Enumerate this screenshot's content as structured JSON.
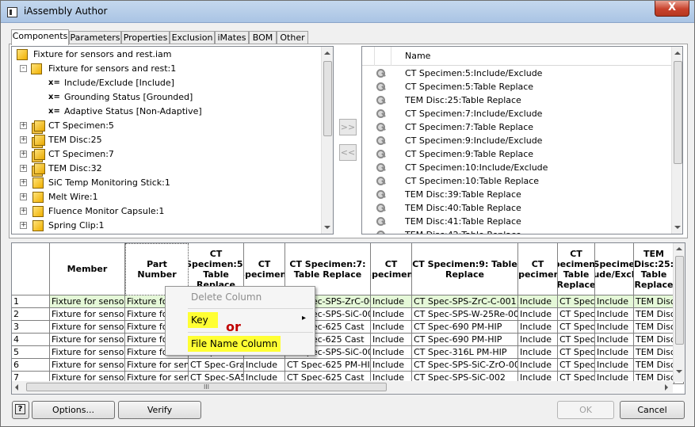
{
  "window": {
    "title": "iAssembly Author",
    "close_glyph": "X"
  },
  "tabs": [
    {
      "label": "Components",
      "active": true
    },
    {
      "label": "Parameters"
    },
    {
      "label": "Properties"
    },
    {
      "label": "Exclusion"
    },
    {
      "label": "iMates"
    },
    {
      "label": "BOM"
    },
    {
      "label": "Other"
    }
  ],
  "tree": [
    {
      "label": "Fixture for sensors and rest.iam",
      "icon": "assembly-icon"
    },
    {
      "label": "Fixture for sensors and rest:1",
      "icon": "assembly-icon",
      "expander": "-"
    },
    {
      "label": "Include/Exclude [Include]",
      "icon": "parameter-icon",
      "glyph": "x="
    },
    {
      "label": "Grounding Status [Grounded]",
      "icon": "parameter-icon",
      "glyph": "x="
    },
    {
      "label": "Adaptive Status [Non-Adaptive]",
      "icon": "parameter-icon",
      "glyph": "x="
    },
    {
      "label": "CT Specimen:5",
      "icon": "multi-assembly-icon",
      "expander": "+"
    },
    {
      "label": "TEM Disc:25",
      "icon": "multi-assembly-icon",
      "expander": "+"
    },
    {
      "label": "CT Specimen:7",
      "icon": "multi-assembly-icon",
      "expander": "+"
    },
    {
      "label": "TEM Disc:32",
      "icon": "multi-assembly-icon",
      "expander": "+"
    },
    {
      "label": "SiC Temp Monitoring Stick:1",
      "icon": "assembly-icon",
      "expander": "+"
    },
    {
      "label": "Melt Wire:1",
      "icon": "assembly-icon",
      "expander": "+"
    },
    {
      "label": "Fluence Monitor Capsule:1",
      "icon": "assembly-icon",
      "expander": "+"
    },
    {
      "label": "Spring Clip:1",
      "icon": "assembly-icon",
      "expander": "+"
    }
  ],
  "move_buttons": {
    "add": ">>",
    "remove": "<<"
  },
  "keylist": {
    "header": "Name",
    "items": [
      "CT Specimen:5:Include/Exclude",
      "CT Specimen:5:Table Replace",
      "TEM Disc:25:Table Replace",
      "CT Specimen:7:Include/Exclude",
      "CT Specimen:7:Table Replace",
      "CT Specimen:9:Include/Exclude",
      "CT Specimen:9:Table Replace",
      "CT Specimen:10:Include/Exclude",
      "CT Specimen:10:Table Replace",
      "TEM Disc:39:Table Replace",
      "TEM Disc:40:Table Replace",
      "TEM Disc:41:Table Replace",
      "TEM Disc:42:Table Replace"
    ]
  },
  "grid": {
    "headers": [
      "",
      "Member",
      "Part Number",
      "CT Specimen:5: Table Replace",
      "CT Specimen:",
      "CT Specimen:7: Table Replace",
      "CT Specimen:",
      "CT Specimen:9: Table Replace",
      "CT Specimen:",
      "CT Specimen:1 Table Replace",
      "CT Specimen:1 Include/Exclude",
      "TEM Disc:25: Table Replace",
      "T"
    ],
    "rows": [
      [
        "1",
        "Fixture for sensors",
        "Fixture for s",
        "CT Spec-Grad",
        "Include",
        "CT Spec-SPS-ZrC-001",
        "Include",
        "CT Spec-SPS-ZrC-C-001",
        "Include",
        "CT Spec-",
        "Include",
        "TEM Disc-",
        "In"
      ],
      [
        "2",
        "Fixture for sensors",
        "Fixture for s",
        "CT Spec-Grad",
        "Include",
        "CT Spec-SPS-SiC-001",
        "Include",
        "CT Spec-SPS-W-25Re-001",
        "Include",
        "CT Spec-",
        "Include",
        "TEM Disc-",
        "In"
      ],
      [
        "3",
        "Fixture for sensors",
        "Fixture for s",
        "CT Spec-Grad",
        "Include",
        "CT Spec-625 Cast",
        "Include",
        "CT Spec-690 PM-HIP",
        "Include",
        "CT Spec-",
        "Include",
        "TEM Disc-",
        "In"
      ],
      [
        "4",
        "Fixture for sensors",
        "Fixture for s",
        "CT Spec-Grad",
        "Include",
        "CT Spec-625 Cast",
        "Include",
        "CT Spec-690 PM-HIP",
        "Include",
        "CT Spec-",
        "Include",
        "TEM Disc-",
        "In"
      ],
      [
        "5",
        "Fixture for sensors",
        "Fixture for senso",
        "CT Spec-Grad",
        "Include",
        "CT Spec-SPS-SiC-003",
        "Include",
        "CT Spec-316L PM-HIP",
        "Include",
        "CT Spec-",
        "Include",
        "TEM Disc-",
        "In"
      ],
      [
        "6",
        "Fixture for sensors",
        "Fixture for senso",
        "CT Spec-Grad",
        "Include",
        "CT Spec-625 PM-HIP",
        "Include",
        "CT Spec-SPS-SiC-ZrO-002",
        "Include",
        "CT Spec-",
        "Include",
        "TEM Disc-",
        "In"
      ],
      [
        "7",
        "Fixture for sensors",
        "Fixture for senso",
        "CT Spec-SA50",
        "Include",
        "CT Spec-625 Cast",
        "Include",
        "CT Spec-SPS-SiC-002",
        "Include",
        "CT Spec-",
        "Include",
        "TEM Disc-",
        "In"
      ]
    ],
    "hscroll_thumb_glyph": "III"
  },
  "context_menu": {
    "items": [
      {
        "label": "Delete Column",
        "disabled": true
      },
      {
        "label": "Key",
        "highlighted": true,
        "submenu": true
      },
      {
        "label": "File Name Column",
        "highlighted": true
      }
    ],
    "submenu_glyph": "▸"
  },
  "annotation": {
    "or_label": "or"
  },
  "buttons": {
    "help": "?",
    "options": "Options...",
    "verify": "Verify",
    "ok": "OK",
    "cancel": "Cancel"
  },
  "colors": {
    "highlight": "#ffff33",
    "annotation": "#c00000",
    "selected_row": "#e5f8d8"
  }
}
